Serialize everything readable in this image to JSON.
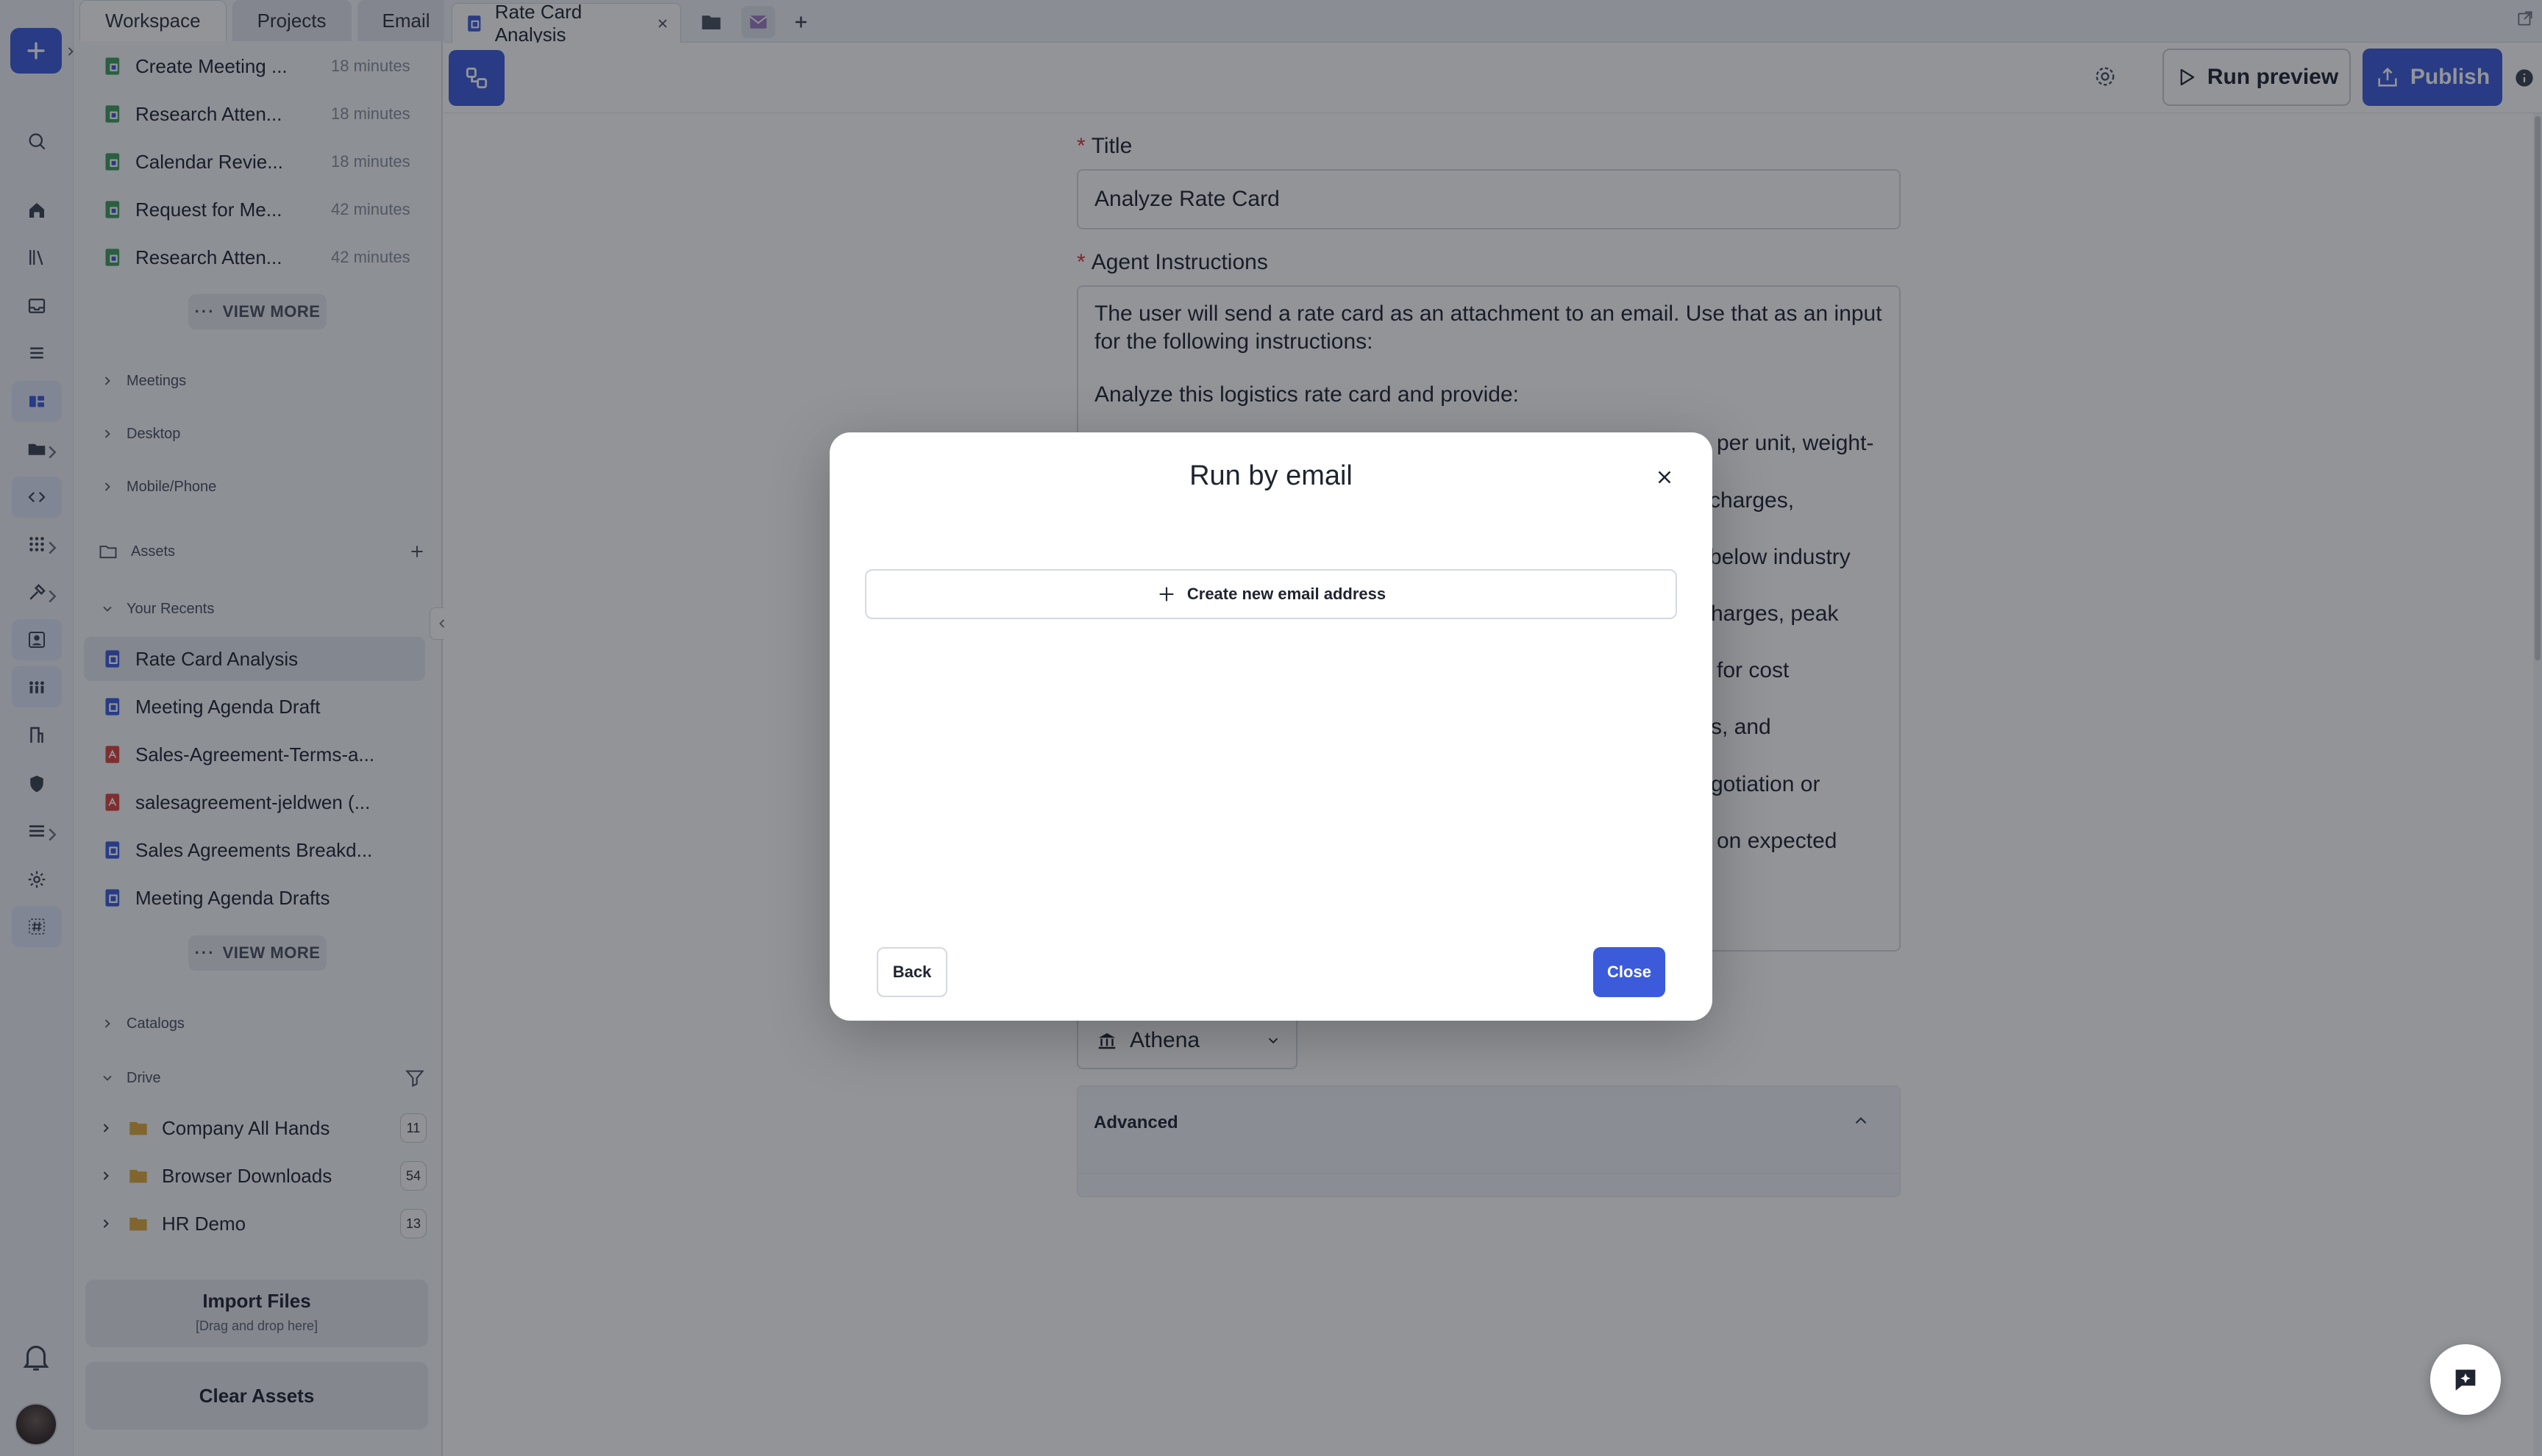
{
  "sidebar_tabs": [
    "Workspace",
    "Projects",
    "Email"
  ],
  "recent_activity": [
    {
      "name": "Create Meeting ...",
      "age": "18 minutes"
    },
    {
      "name": "Research Atten...",
      "age": "18 minutes"
    },
    {
      "name": "Calendar Revie...",
      "age": "18 minutes"
    },
    {
      "name": "Request for Me...",
      "age": "42 minutes"
    },
    {
      "name": "Research Atten...",
      "age": "42 minutes"
    }
  ],
  "view_more": "VIEW MORE",
  "sections": {
    "meetings": "Meetings",
    "desktop": "Desktop",
    "mobile": "Mobile/Phone",
    "assets": "Assets",
    "your_recents": "Your Recents",
    "catalogs": "Catalogs",
    "drive": "Drive"
  },
  "recents": [
    {
      "name": "Rate Card Analysis",
      "kind": "doc"
    },
    {
      "name": "Meeting Agenda Draft",
      "kind": "doc"
    },
    {
      "name": "Sales-Agreement-Terms-a...",
      "kind": "pdf"
    },
    {
      "name": "salesagreement-jeldwen (...",
      "kind": "pdf"
    },
    {
      "name": "Sales Agreements Breakd...",
      "kind": "doc"
    },
    {
      "name": "Meeting Agenda Drafts",
      "kind": "doc"
    }
  ],
  "drive_folders": [
    {
      "name": "Company All Hands",
      "count": "11"
    },
    {
      "name": "Browser Downloads",
      "count": "54"
    },
    {
      "name": "HR Demo",
      "count": "13"
    }
  ],
  "import_files": {
    "title": "Import Files",
    "subtitle": "[Drag and drop here]"
  },
  "clear_assets": "Clear Assets",
  "open_tab": {
    "title": "Rate Card Analysis"
  },
  "toolbar": {
    "run_preview": "Run preview",
    "publish": "Publish"
  },
  "form": {
    "title_label": "Title",
    "title_value": "Analyze Rate Card",
    "instructions_label": "Agent Instructions",
    "instructions_line1": "The user will send a rate card as an attachment to an email. Use that as an input for the following instructions:",
    "instructions_line2": "Analyze this logistics rate card and provide:",
    "visible_fragments": [
      "per unit, weight-",
      "charges,",
      "below industry",
      "harges, peak",
      "for cost",
      "s, and",
      "gotiation or",
      "on expected"
    ],
    "model": "Athena",
    "advanced": "Advanced"
  },
  "modal": {
    "title": "Run by email",
    "create_button": "Create new email address",
    "back": "Back",
    "close": "Close"
  },
  "colors": {
    "accent": "#3b5bdb",
    "required": "#e03131",
    "overlay": "rgba(18,22,30,0.46)"
  }
}
